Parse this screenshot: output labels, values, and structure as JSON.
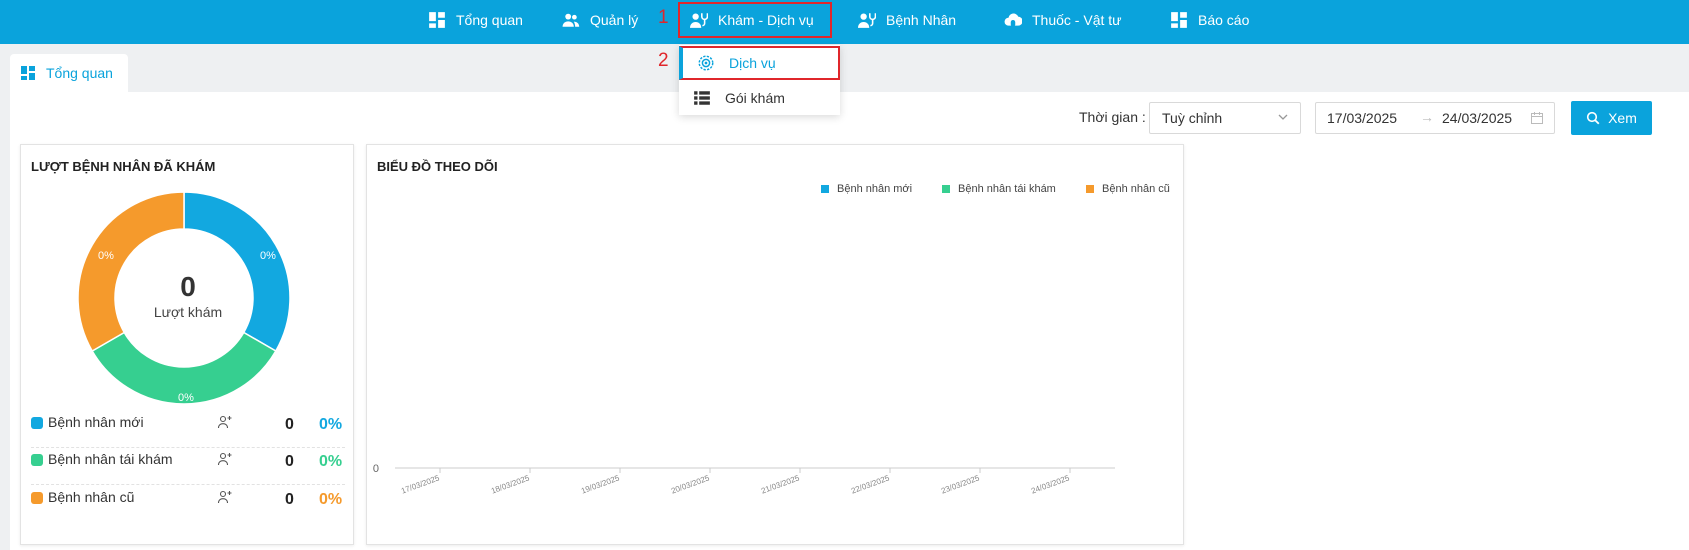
{
  "nav": {
    "items": [
      {
        "label": "Tổng quan",
        "icon": "dashboard-icon"
      },
      {
        "label": "Quản lý",
        "icon": "users-icon"
      },
      {
        "label": "Khám - Dịch vụ",
        "icon": "user-stethoscope-icon"
      },
      {
        "label": "Bệnh Nhân",
        "icon": "user-stethoscope-icon"
      },
      {
        "label": "Thuốc - Vật tư",
        "icon": "cloud-pill-icon"
      },
      {
        "label": "Báo cáo",
        "icon": "dashboard-icon"
      }
    ],
    "active_index": 2
  },
  "steps": {
    "one": "1",
    "two": "2"
  },
  "dropdown": {
    "items": [
      {
        "label": "Dịch vụ",
        "icon": "gear-service-icon"
      },
      {
        "label": "Gói khám",
        "icon": "list-icon"
      }
    ]
  },
  "tab": {
    "label": "Tổng quan",
    "icon": "dashboard-icon"
  },
  "filter": {
    "label": "Thời gian :",
    "select_value": "Tuỳ chỉnh",
    "date_from": "17/03/2025",
    "date_to": "24/03/2025",
    "arrow": "→",
    "button_label": "Xem"
  },
  "summary": {
    "title": "LƯỢT BỆNH NHÂN ĐÃ KHÁM",
    "total": "0",
    "total_label": "Lượt khám",
    "rows": [
      {
        "label": "Bệnh nhân mới",
        "count": "0",
        "percent": "0%",
        "color": "#12a8e0"
      },
      {
        "label": "Bệnh nhân tái khám",
        "count": "0",
        "percent": "0%",
        "color": "#36cf90"
      },
      {
        "label": "Bệnh nhân cũ",
        "count": "0",
        "percent": "0%",
        "color": "#f59a2c"
      }
    ]
  },
  "chart_data": [
    {
      "type": "pie",
      "title": "LƯỢT BỆNH NHÂN ĐÃ KHÁM",
      "categories": [
        "Bệnh nhân mới",
        "Bệnh nhân tái khám",
        "Bệnh nhân cũ"
      ],
      "values": [
        1,
        1,
        1
      ],
      "labels": [
        "0%",
        "0%",
        "0%"
      ],
      "colors": [
        "#12a8e0",
        "#36cf90",
        "#f59a2c"
      ]
    },
    {
      "type": "line",
      "title": "BIỂU ĐỒ THEO DÕI",
      "x": [
        "17/03/2025",
        "18/03/2025",
        "19/03/2025",
        "20/03/2025",
        "21/03/2025",
        "22/03/2025",
        "23/03/2025",
        "24/03/2025"
      ],
      "series": [
        {
          "name": "Bệnh nhân mới",
          "values": [
            0,
            0,
            0,
            0,
            0,
            0,
            0,
            0
          ],
          "color": "#12a8e0"
        },
        {
          "name": "Bệnh nhân tái khám",
          "values": [
            0,
            0,
            0,
            0,
            0,
            0,
            0,
            0
          ],
          "color": "#36cf90"
        },
        {
          "name": "Bệnh nhân cũ",
          "values": [
            0,
            0,
            0,
            0,
            0,
            0,
            0,
            0
          ],
          "color": "#f59a2c"
        }
      ],
      "y_ticks": [
        "0"
      ],
      "ylim": [
        0,
        1
      ],
      "legend": "top-right",
      "grid": false
    }
  ]
}
